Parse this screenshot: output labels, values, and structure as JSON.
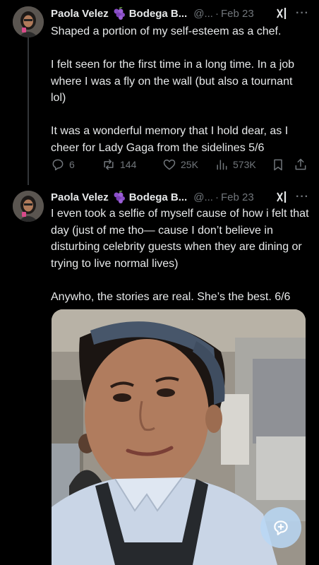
{
  "tweets": [
    {
      "author": {
        "name": "Paola Velez",
        "bodega": "Bodega B...",
        "handle": "@...",
        "separator": "·",
        "date": "Feb 23"
      },
      "paragraphs": [
        "Shaped a portion of my self-esteem as a chef.",
        "I felt seen for the first time in a long time. In a job where I was a fly on the wall (but also a tournant lol)",
        "It was a wonderful memory that I hold dear, as I cheer for Lady Gaga from the sidelines 5/6"
      ],
      "stats": {
        "replies": "6",
        "retweets": "144",
        "likes": "25K",
        "views": "573K"
      }
    },
    {
      "author": {
        "name": "Paola Velez",
        "bodega": "Bodega B...",
        "handle": "@...",
        "separator": "·",
        "date": "Feb 23"
      },
      "paragraphs": [
        "I even took a selfie of myself cause of how i felt that day (just of me tho— cause I don’t believe in disturbing celebrity guests when they are dining or trying to live normal lives)",
        "Anywho, the stories are real. She’s the best. 6/6"
      ]
    }
  ],
  "icons": {
    "more": "more-icon",
    "grok": "grok-icon",
    "reply": "reply-icon",
    "retweet": "retweet-icon",
    "like": "heart-icon",
    "views": "views-icon",
    "bookmark": "bookmark-icon",
    "share": "share-icon",
    "compose": "compose-icon"
  },
  "colors": {
    "background": "#000000",
    "text": "#e7e9ea",
    "muted": "#71767b",
    "fab": "#b9d7f5"
  },
  "more_label": "···"
}
